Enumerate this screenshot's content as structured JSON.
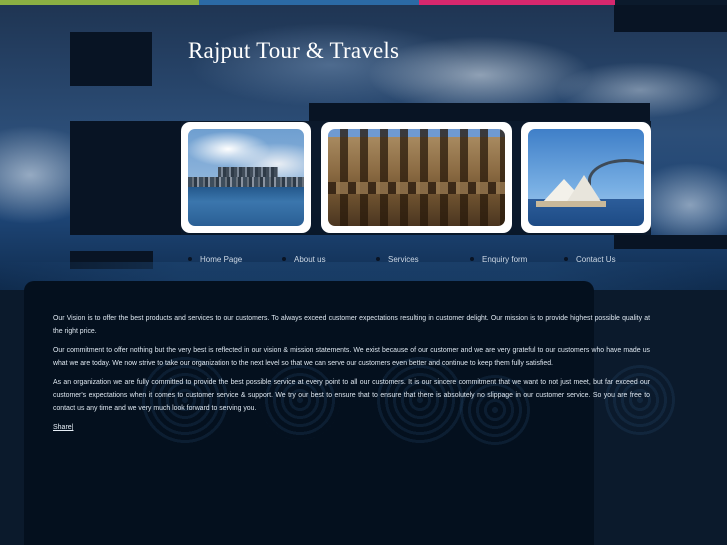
{
  "site": {
    "title": "Rajput Tour & Travels"
  },
  "stripe_colors": [
    "#8bb043",
    "#2b6aa5",
    "#d6286e"
  ],
  "photos": [
    {
      "name": "skyline-photo"
    },
    {
      "name": "colosseum-photo"
    },
    {
      "name": "opera-house-photo"
    }
  ],
  "nav": {
    "items": [
      {
        "label": "Home Page"
      },
      {
        "label": "About us"
      },
      {
        "label": "Services"
      },
      {
        "label": "Enquiry form"
      },
      {
        "label": "Contact Us"
      }
    ]
  },
  "content": {
    "paragraphs": [
      "Our Vision is to offer the best products and services to our customers. To always exceed customer expectations resulting in customer delight. Our mission is to provide highest possible quality at the right price.",
      "Our commitment to offer nothing but the very best is reflected in our vision & mission statements. We exist because of our customer and we are very grateful to our customers who have made us what we are today. We now strive to take our organization to the next level so that we can serve our customers even better and continue to keep them fully satisfied.",
      "As an organization we are fully committed to provide the best possible service at every point to all our customers. It is our sincere commitment that we want to not just meet, but far exceed our customer's expectations when it comes to customer service & support. We try our best to ensure that to ensure that there is absolutely no slippage in our customer service. So you are free to contact us any time and we very much look forward to serving you."
    ],
    "share_label": "Share|"
  },
  "colors": {
    "background": "#0b1a2c",
    "panel": "#04101e",
    "text": "#dde6ef"
  }
}
